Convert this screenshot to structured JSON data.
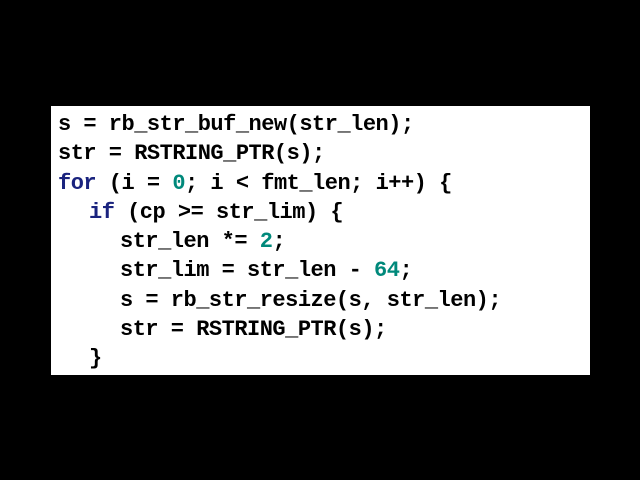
{
  "code": {
    "line1": "s = rb_str_buf_new(str_len);",
    "line2": "str = RSTRING_PTR(s);",
    "line3": {
      "kw": "for",
      "a": " (i = ",
      "n": "0",
      "b": "; i < fmt_len; i++) {"
    },
    "line4": {
      "kw": "if",
      "a": " (cp >= str_lim) {"
    },
    "line5": {
      "a": "str_len *= ",
      "n": "2",
      "b": ";"
    },
    "line6": {
      "a": "str_lim = str_len - ",
      "n": "64",
      "b": ";"
    },
    "line7": "s = rb_str_resize(s, str_len);",
    "line8": "str = RSTRING_PTR(s);",
    "line9": "}"
  },
  "colors": {
    "background": "#000000",
    "panel": "#ffffff",
    "keyword": "#1a237e",
    "number": "#00897b"
  }
}
